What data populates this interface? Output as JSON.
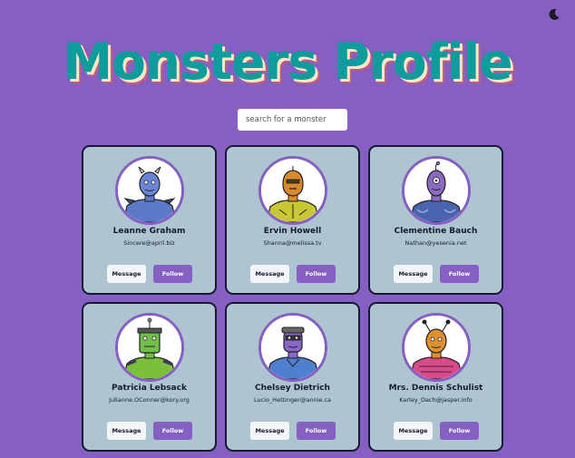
{
  "page": {
    "title": "Monsters Profile",
    "search_placeholder": "search for a monster",
    "theme_icon": "moon-icon"
  },
  "colors": {
    "background": "#8560c2",
    "title": "#0e9c9c",
    "card": "#aec5d1",
    "accent": "#8560c2"
  },
  "buttons": {
    "message_label": "Message",
    "follow_label": "Follow"
  },
  "monsters": [
    {
      "name": "Leanne Graham",
      "email": "Sincere@april.biz",
      "body_color": "#5a79c7",
      "head_color": "#6b85d6"
    },
    {
      "name": "Ervin Howell",
      "email": "Shanna@melissa.tv",
      "body_color": "#c9c736",
      "head_color": "#d98a2e"
    },
    {
      "name": "Clementine Bauch",
      "email": "Nathan@yesenia.net",
      "body_color": "#4a64b0",
      "head_color": "#8b6bc0"
    },
    {
      "name": "Patricia Lebsack",
      "email": "Julianne.OConner@kory.org",
      "body_color": "#7cbf3a",
      "head_color": "#6fbf4a"
    },
    {
      "name": "Chelsey Dietrich",
      "email": "Lucio_Hettinger@annie.ca",
      "body_color": "#4f7fcf",
      "head_color": "#8a66c8"
    },
    {
      "name": "Mrs. Dennis Schulist",
      "email": "Karley_Dach@jasper.info",
      "body_color": "#d84a8a",
      "head_color": "#e0902e"
    }
  ]
}
